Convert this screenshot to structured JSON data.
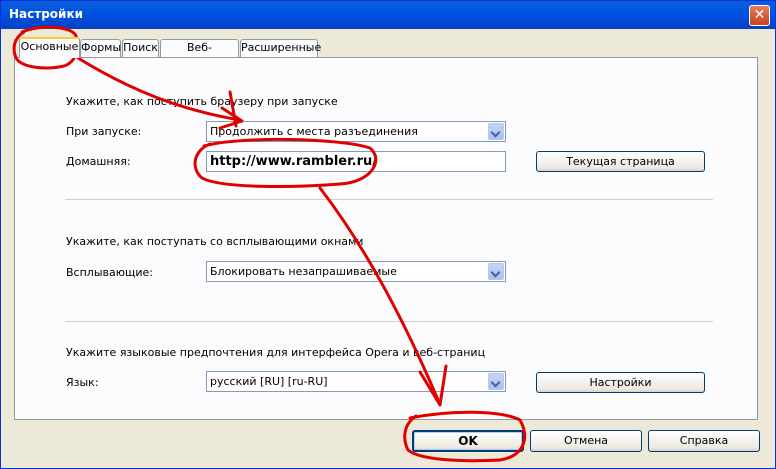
{
  "window": {
    "title": "Настройки",
    "close_label": "✕"
  },
  "tabs": [
    {
      "label": "Основные",
      "active": true
    },
    {
      "label": "Формы"
    },
    {
      "label": "Поиск"
    },
    {
      "label": "Веб-страницы"
    },
    {
      "label": "Расширенные"
    }
  ],
  "startup": {
    "heading": "Укажите, как поступить браузеру при запуске",
    "label": "При запуске:",
    "value": "Продолжить с места разъединения",
    "home_label": "Домашняя:",
    "home_value": "http://www.rambler.ru/",
    "current_page_button": "Текущая страница"
  },
  "popups": {
    "heading": "Укажите, как поступать со всплывающими окнами",
    "label": "Всплывающие:",
    "value": "Блокировать незапрашиваемые"
  },
  "language": {
    "heading": "Укажите языковые предпочтения для интерфейса Opera и веб-страниц",
    "label": "Язык:",
    "value": "русский [RU] [ru-RU]",
    "settings_button": "Настройки"
  },
  "footer": {
    "ok": "OK",
    "cancel": "Отмена",
    "help": "Справка"
  },
  "colors": {
    "annotation": "#e00000",
    "title_bar": "#0153e3"
  }
}
